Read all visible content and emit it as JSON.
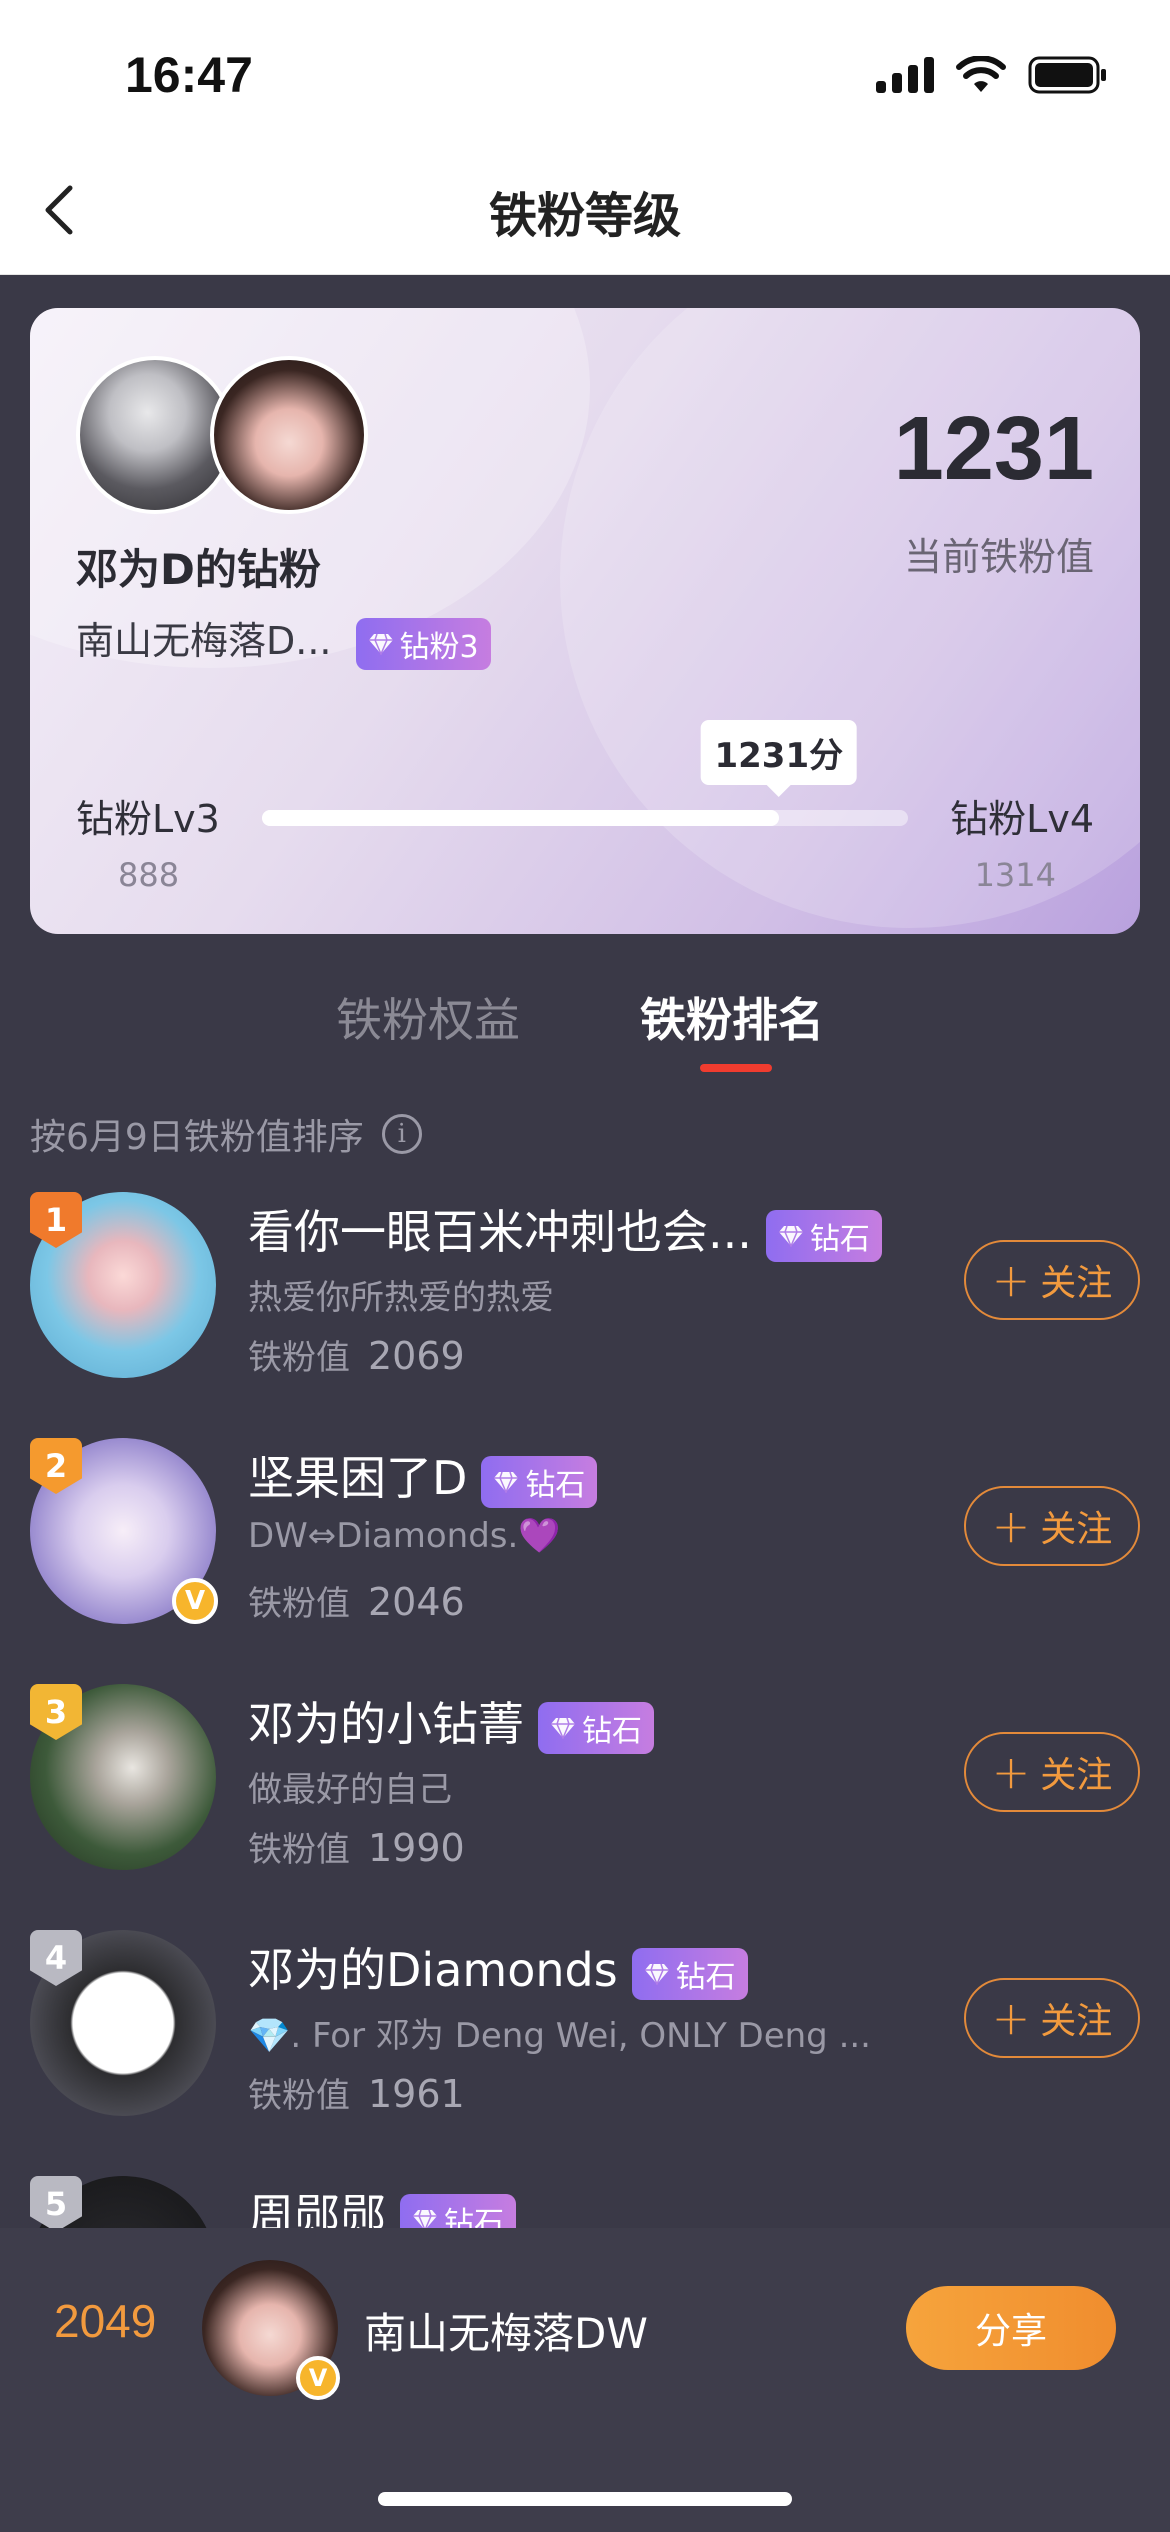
{
  "status": {
    "time": "16:47"
  },
  "nav": {
    "title": "铁粉等级"
  },
  "card": {
    "group_name": "邓为D的钻粉",
    "user_name": "南山无梅落D...",
    "user_badge": "钻粉3",
    "score": "1231",
    "score_label": "当前铁粉值",
    "tooltip": "1231分",
    "level_current": "钻粉Lv3",
    "level_next": "钻粉Lv4",
    "level_current_value": "888",
    "level_next_value": "1314",
    "progress_fraction": 0.8
  },
  "tabs": {
    "benefits": "铁粉权益",
    "ranking": "铁粉排名"
  },
  "sort_text": "按6月9日铁粉值排序",
  "value_label": "铁粉值",
  "follow_label": "关注",
  "ranking": [
    {
      "rank": "1",
      "name": "看你一眼百米冲刺也会...",
      "badge": "钻石",
      "desc": "热爱你所热爱的热爱",
      "value": "2069",
      "rank_color": "#f07a2c",
      "verified": false
    },
    {
      "rank": "2",
      "name": "坚果困了D",
      "badge": "钻石",
      "desc": "DW⇔Diamonds.💜",
      "value": "2046",
      "rank_color": "#f59a2e",
      "verified": true
    },
    {
      "rank": "3",
      "name": "邓为的小钻菁",
      "badge": "钻石",
      "desc": "做最好的自己",
      "value": "1990",
      "rank_color": "#f2b634",
      "verified": false
    },
    {
      "rank": "4",
      "name": "邓为的Diamonds",
      "badge": "钻石",
      "desc": "💎. For 邓为 Deng Wei, ONLY Deng ...",
      "value": "1961",
      "rank_color": "#b9b9c2",
      "verified": false
    },
    {
      "rank": "5",
      "name": "周郧郧",
      "badge": "钻石",
      "desc": "",
      "value": "",
      "rank_color": "#b9b9c2",
      "verified": false
    }
  ],
  "me": {
    "value": "2049",
    "name": "南山无梅落DW",
    "share_label": "分享"
  },
  "colors": {
    "accent": "#f29a3e",
    "tab_indicator": "#f03c2f",
    "badge_purple": "#9b6ff0"
  }
}
